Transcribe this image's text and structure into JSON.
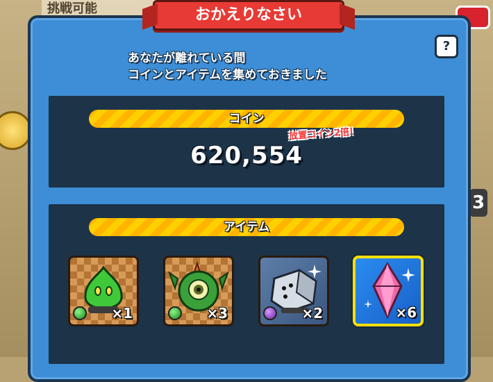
{
  "background": {
    "banner_text": "挑戦可能",
    "side_number": "3"
  },
  "dialog": {
    "title": "おかえりなさい",
    "help_label": "?",
    "message_line1": "あなたが離れている間",
    "message_line2": "コインとアイテムを集めておきました"
  },
  "coin_section": {
    "header": "コイン",
    "bonus_label": "放置コイン2倍!",
    "amount": "620,554"
  },
  "item_section": {
    "header": "アイテム",
    "items": [
      {
        "icon": "green-slime-icon",
        "quantity": "×1",
        "frame": "checker",
        "orb": "green"
      },
      {
        "icon": "green-cyclops-icon",
        "quantity": "×3",
        "frame": "checker",
        "orb": "green"
      },
      {
        "icon": "silver-golem-icon",
        "quantity": "×2",
        "frame": "silver",
        "orb": "purple"
      },
      {
        "icon": "pink-gem-icon",
        "quantity": "×6",
        "frame": "gem",
        "orb": ""
      }
    ]
  },
  "colors": {
    "panel": "#3d8ed6",
    "section": "#1d3348",
    "title_plate": "#e83a35",
    "stripe": "#ffd000",
    "bonus_text": "#ff3e3e"
  }
}
